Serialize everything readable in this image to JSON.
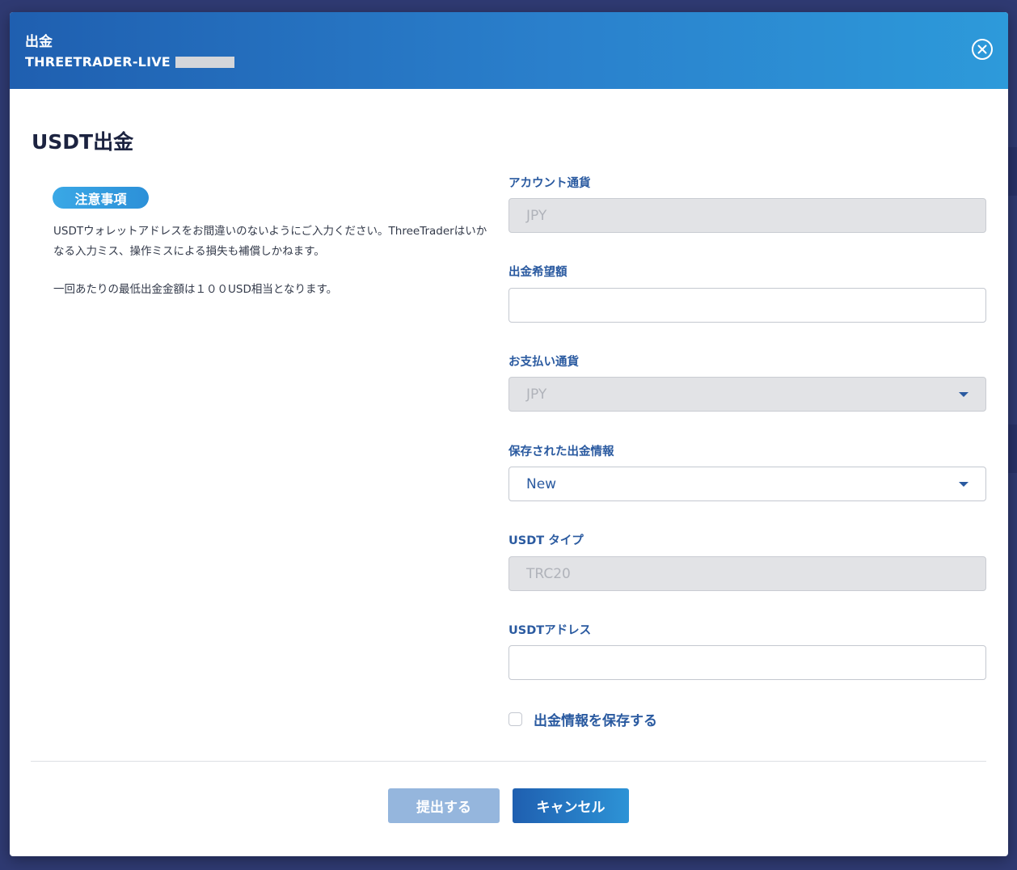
{
  "dialog": {
    "title": "出金",
    "subtitle": "THREETRADER-LIVE -"
  },
  "page_title": "USDT出金",
  "notice": {
    "badge": "注意事項",
    "line1": "USDTウォレットアドレスをお間違いのないようにご入力ください。ThreeTraderはいかなる入力ミス、操作ミスによる損失も補償しかねます。",
    "line2": "一回あたりの最低出金金額は１００USD相当となります。"
  },
  "form": {
    "account_currency": {
      "label": "アカウント通貨",
      "value": "JPY"
    },
    "amount": {
      "label": "出金希望額",
      "value": ""
    },
    "payment_currency": {
      "label": "お支払い通貨",
      "value": "JPY"
    },
    "saved_info": {
      "label": "保存された出金情報",
      "value": "New"
    },
    "usdt_type": {
      "label": "USDT タイプ",
      "value": "TRC20"
    },
    "usdt_address": {
      "label": "USDTアドレス",
      "value": ""
    },
    "save_checkbox_label": "出金情報を保存する"
  },
  "buttons": {
    "submit": "提出する",
    "cancel": "キャンセル"
  },
  "colors": {
    "header_gradient_start": "#1f5fb0",
    "header_gradient_end": "#2d9ada",
    "label_blue": "#2a5aa0",
    "submit_disabled": "#95b6dd"
  },
  "icons": {
    "close": "close-circle-icon",
    "dropdown": "caret-down-icon"
  }
}
